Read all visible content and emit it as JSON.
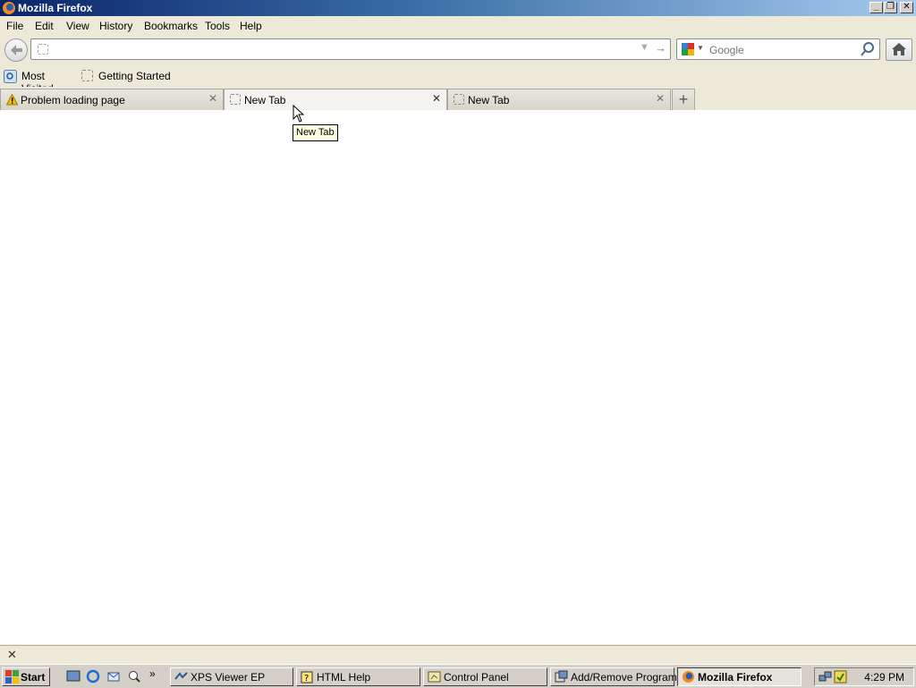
{
  "window": {
    "title": "Mozilla Firefox"
  },
  "menu": [
    "File",
    "Edit",
    "View",
    "History",
    "Bookmarks",
    "Tools",
    "Help"
  ],
  "nav": {
    "url_value": "",
    "search_placeholder": "Google"
  },
  "bookmarks": [
    {
      "label": "Most Visited",
      "icon": "most-visited-icon"
    },
    {
      "label": "Getting Started",
      "icon": "page-icon"
    }
  ],
  "tabs": [
    {
      "label": "Problem loading page",
      "icon": "warning-icon",
      "active": false
    },
    {
      "label": "New Tab",
      "icon": "page-icon",
      "active": true
    },
    {
      "label": "New Tab",
      "icon": "page-icon",
      "active": false
    }
  ],
  "tooltip": "New Tab",
  "taskbar": {
    "start_label": "Start",
    "tasks": [
      {
        "label": "XPS Viewer EP"
      },
      {
        "label": "HTML Help"
      },
      {
        "label": "Control Panel"
      },
      {
        "label": "Add/Remove Programs"
      },
      {
        "label": "Mozilla Firefox",
        "active": true
      }
    ],
    "clock": "4:29 PM"
  },
  "colors": {
    "title_start": "#0a246a",
    "title_end": "#a6caf0",
    "tooltip_bg": "#ffffe1",
    "warning": "#f0c000"
  }
}
